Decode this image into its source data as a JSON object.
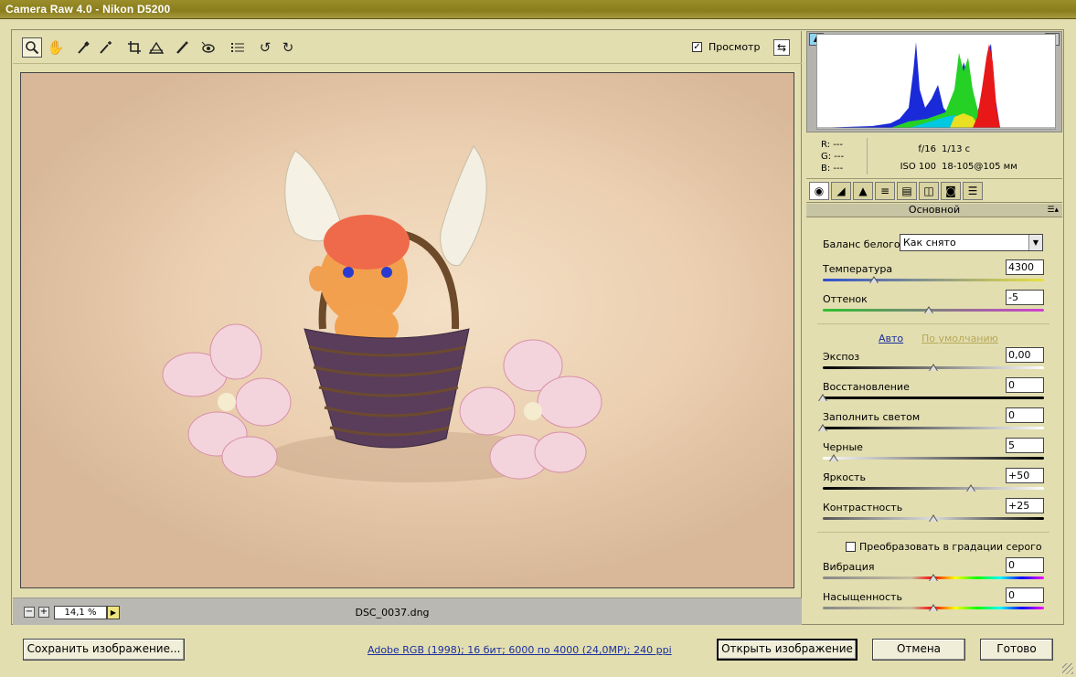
{
  "window": {
    "title": "Camera Raw 4.0  -  Nikon D5200"
  },
  "toolbar": {
    "tools": [
      "zoom-icon",
      "hand-icon",
      "white-balance-icon",
      "color-sampler-icon",
      "crop-icon",
      "straighten-icon",
      "retouch-icon",
      "red-eye-icon",
      "preferences-icon",
      "rotate-left-icon",
      "rotate-right-icon"
    ],
    "preview_label": "Просмотр",
    "preview_checked": true
  },
  "bottombar": {
    "zoom_value": "14,1 %",
    "filename": "DSC_0037.dng"
  },
  "histogram": {
    "r": "R:   ---",
    "g": "G:   ---",
    "b": "B:   ---",
    "aperture": "f/16",
    "shutter": "1/13 с",
    "iso": "ISO 100",
    "lens": "18-105@105 мм"
  },
  "panel": {
    "title": "Основной",
    "white_balance_label": "Баланс белого:",
    "white_balance_value": "Как снято",
    "auto_link": "Авто",
    "default_link": "По умолчанию",
    "grayscale_label": "Преобразовать в градации серого",
    "sliders": [
      {
        "label": "Температура",
        "value": "4300",
        "pos": 0.23
      },
      {
        "label": "Оттенок",
        "value": "-5",
        "pos": 0.48
      },
      {
        "label": "Экспоз",
        "value": "0,00",
        "pos": 0.5
      },
      {
        "label": "Восстановление",
        "value": "0",
        "pos": 0.0
      },
      {
        "label": "Заполнить светом",
        "value": "0",
        "pos": 0.0
      },
      {
        "label": "Черные",
        "value": "5",
        "pos": 0.05
      },
      {
        "label": "Яркость",
        "value": "+50",
        "pos": 0.67
      },
      {
        "label": "Контрастность",
        "value": "+25",
        "pos": 0.5
      },
      {
        "label": "Вибрация",
        "value": "0",
        "pos": 0.5
      },
      {
        "label": "Насыщенность",
        "value": "0",
        "pos": 0.5
      }
    ]
  },
  "footer": {
    "save_label": "Сохранить изображение...",
    "workflow_link": "Adobe RGB (1998); 16 бит; 6000 по 4000 (24,0MP); 240 ppi",
    "open_label": "Открыть изображение",
    "cancel_label": "Отмена",
    "done_label": "Готово"
  }
}
